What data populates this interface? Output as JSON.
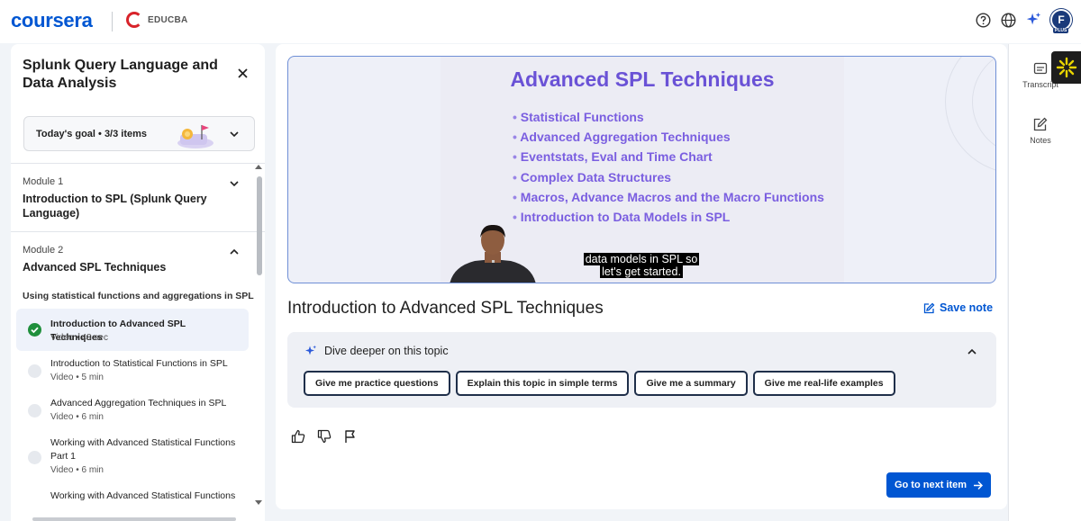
{
  "brand": {
    "logo": "coursera",
    "partner": "EDUCBA"
  },
  "header": {
    "avatar_initial": "F",
    "plus_label": "PLUS"
  },
  "sidebar": {
    "course_title": "Splunk Query Language and Data Analysis",
    "goal": {
      "label": "Today's goal • 3/3 items"
    },
    "modules": [
      {
        "number": "Module 1",
        "title": "Introduction to SPL (Splunk Query Language)",
        "expanded": false
      },
      {
        "number": "Module 2",
        "title": "Advanced SPL Techniques",
        "expanded": true
      }
    ],
    "lesson_heading": "Using statistical functions and aggregations in SPL",
    "items": [
      {
        "title": "Introduction to Advanced SPL Techniques",
        "type": "Video",
        "duration": "48 sec",
        "completed": true,
        "active": true
      },
      {
        "title": "Introduction to Statistical Functions in SPL",
        "type": "Video",
        "duration": "5 min",
        "completed": false,
        "active": false
      },
      {
        "title": "Advanced Aggregation Techniques in SPL",
        "type": "Video",
        "duration": "6 min",
        "completed": false,
        "active": false
      },
      {
        "title": "Working with Advanced Statistical Functions Part 1",
        "type": "Video",
        "duration": "6 min",
        "completed": false,
        "active": false
      },
      {
        "title": "Working with Advanced Statistical Functions",
        "type": "",
        "duration": "",
        "completed": false,
        "active": false
      }
    ],
    "meta_sep": "•"
  },
  "video": {
    "slide_title": "Advanced SPL Techniques",
    "bullets": [
      "Statistical Functions",
      "Advanced Aggregation Techniques",
      "Eventstats, Eval and Time Chart",
      "Complex Data Structures",
      "Macros, Advance Macros and the Macro Functions",
      "Introduction to Data Models in SPL"
    ],
    "caption_line1": "data models in SPL so",
    "caption_line2": "let's get started."
  },
  "main": {
    "title": "Introduction to Advanced SPL Techniques",
    "save_note": "Save note",
    "dive_label": "Dive deeper on this topic",
    "chips": [
      "Give me practice questions",
      "Explain this topic in simple terms",
      "Give me a summary",
      "Give me real-life examples"
    ],
    "next_button": "Go to next item"
  },
  "rail": {
    "transcript": "Transcript",
    "notes": "Notes"
  },
  "colors": {
    "brand_blue": "#0056d2",
    "slide_purple": "#6a52d6",
    "success_green": "#1f8f3c"
  }
}
